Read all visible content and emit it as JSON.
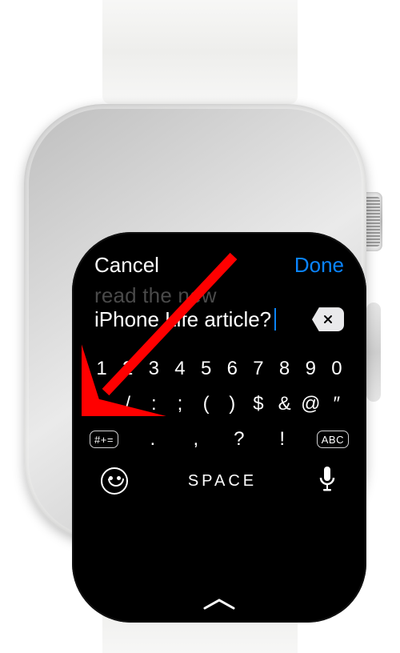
{
  "navbar": {
    "cancel": "Cancel",
    "done": "Done"
  },
  "textarea": {
    "prev_line": "read the new",
    "current_line": "iPhone Life article?"
  },
  "keyboard": {
    "row1": [
      "1",
      "2",
      "3",
      "4",
      "5",
      "6",
      "7",
      "8",
      "9",
      "0"
    ],
    "row2": [
      "-",
      "/",
      ":",
      ";",
      "(",
      ")",
      "$",
      "&",
      "@",
      "″"
    ],
    "row3_mid": [
      ".",
      ",",
      "?",
      "!"
    ],
    "switch_symbols_label": "#+=",
    "switch_alpha_label": "ABC",
    "space_label": "SPACE"
  },
  "annotation": {
    "arrow_color": "#ff0000"
  }
}
